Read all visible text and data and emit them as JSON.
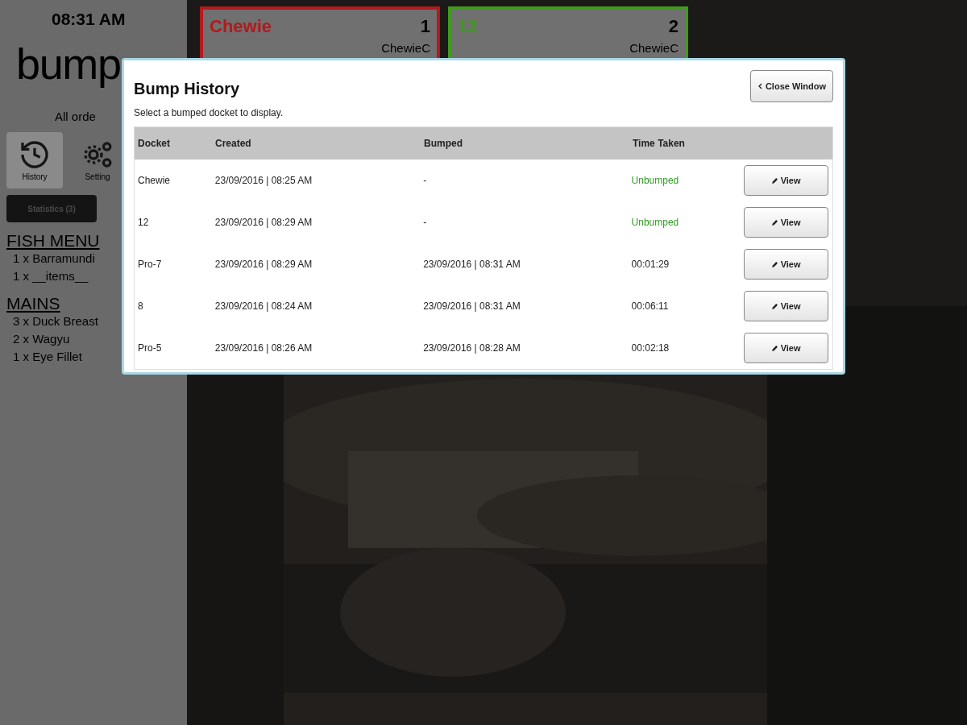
{
  "sidebar": {
    "clock": "08:31 AM",
    "logo": "bump",
    "filter": "All orde",
    "tools": [
      {
        "label": "History",
        "selected": true
      },
      {
        "label": "Setting",
        "selected": false
      }
    ],
    "tabs": [
      {
        "label": "Statistics (3)",
        "selected": true
      }
    ],
    "groups": [
      {
        "title": "FISH MENU",
        "items": [
          "1 x Barramundi",
          "1 x __items__"
        ]
      },
      {
        "title": "MAINS",
        "items": [
          "3 x Duck Breast",
          "2 x Wagyu",
          "1 x Eye Fillet"
        ]
      }
    ]
  },
  "dockets": [
    {
      "name": "Chewie",
      "number": "1",
      "server": "ChewieC",
      "color": "#b3191c"
    },
    {
      "name": "12",
      "number": "2",
      "server": "ChewieC",
      "color": "#3f9a1e"
    }
  ],
  "modal": {
    "title": "Bump History",
    "close": "Close Window",
    "hint": "Select a bumped docket to display.",
    "columns": [
      "Docket",
      "Created",
      "Bumped",
      "Time Taken"
    ],
    "rows": [
      {
        "docket": "Chewie",
        "created": "23/09/2016 | 08:25 AM",
        "bumped": "-",
        "time_taken": "Unbumped",
        "unbumped": true,
        "action": "View"
      },
      {
        "docket": "12",
        "created": "23/09/2016 | 08:29 AM",
        "bumped": "-",
        "time_taken": "Unbumped",
        "unbumped": true,
        "action": "View"
      },
      {
        "docket": "Pro-7",
        "created": "23/09/2016 | 08:29 AM",
        "bumped": "23/09/2016 | 08:31 AM",
        "time_taken": "00:01:29",
        "unbumped": false,
        "action": "View"
      },
      {
        "docket": "8",
        "created": "23/09/2016 | 08:24 AM",
        "bumped": "23/09/2016 | 08:31 AM",
        "time_taken": "00:06:11",
        "unbumped": false,
        "action": "View"
      },
      {
        "docket": "Pro-5",
        "created": "23/09/2016 | 08:26 AM",
        "bumped": "23/09/2016 | 08:28 AM",
        "time_taken": "00:02:18",
        "unbumped": false,
        "action": "View"
      }
    ]
  }
}
